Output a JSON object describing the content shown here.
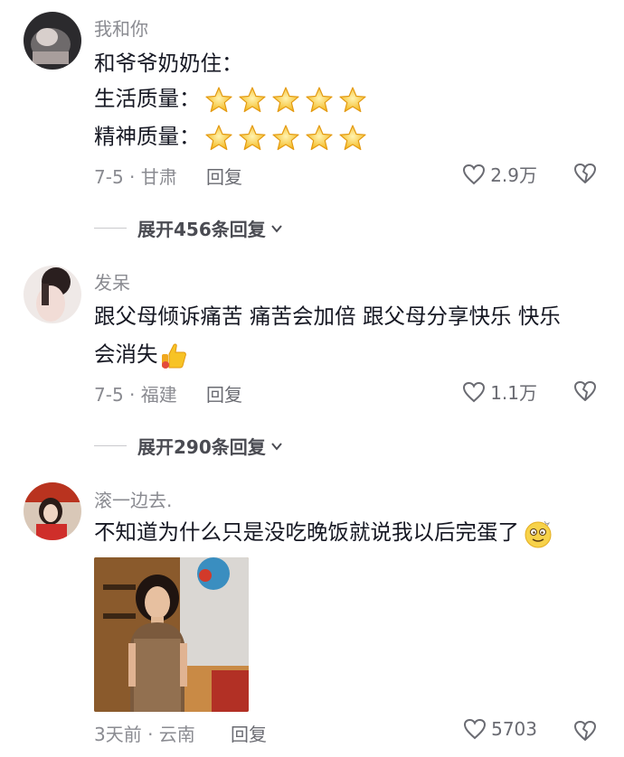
{
  "comments": [
    {
      "username": "我和你",
      "lines": [
        "和爷爷奶奶住：",
        "生活质量：",
        "精神质量："
      ],
      "rating_stars": [
        5,
        5
      ],
      "date_location": "7-5 · 甘肃",
      "reply_label": "回复",
      "likes": "2.9万",
      "expand_label": "展开456条回复"
    },
    {
      "username": "发呆",
      "lines": [
        "跟父母倾诉痛苦 痛苦会加倍 跟父母分享快乐 快乐",
        "会消失"
      ],
      "emoji": "thumbs-up",
      "date_location": "7-5 · 福建",
      "reply_label": "回复",
      "likes": "1.1万",
      "expand_label": "展开290条回复"
    },
    {
      "username": "滚一边去.",
      "lines": [
        "不知道为什么只是没吃晚饭就说我以后完蛋了"
      ],
      "emoji": "dizzy-face",
      "date_location": "3天前 · 云南",
      "reply_label": "回复",
      "likes": "5703"
    }
  ],
  "colors": {
    "text": "#161823",
    "secondary": "#8a8b91",
    "star": "#f7c325"
  }
}
